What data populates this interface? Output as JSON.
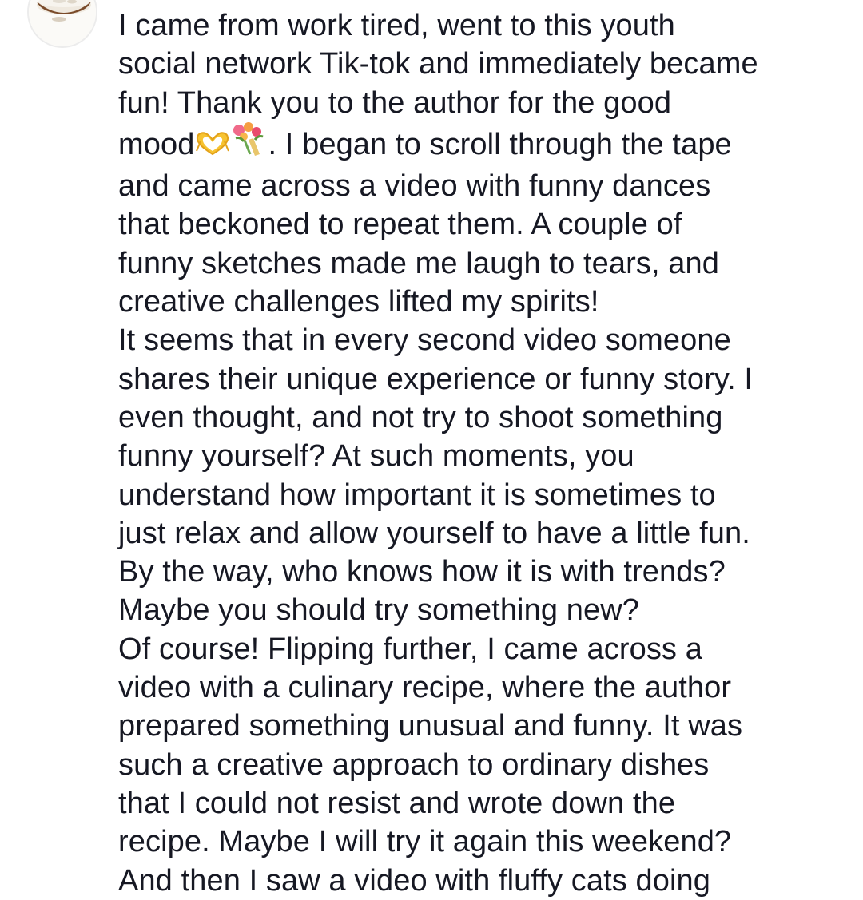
{
  "comment": {
    "avatar_icon": "food-bowl-avatar-icon",
    "lines": {
      "l1": "I came from work tired, went to this youth",
      "l2": "social network Tik-tok and immediately became",
      "l3": "fun! Thank you to the author for the good",
      "l4a": "mood",
      "l4b": ". I began to scroll through the tape",
      "l5": "and came across a video with funny dances",
      "l6": "that beckoned to repeat them. A couple of",
      "l7": "funny sketches made me laugh to tears, and",
      "l8": "creative challenges lifted my spirits!",
      "l9": "It seems that in every second video someone",
      "l10": "shares their unique experience or funny story. I",
      "l11": "even thought, and not try to shoot something",
      "l12": "funny yourself? At such moments, you",
      "l13": "understand how important it is sometimes to",
      "l14": "just relax and allow yourself to have a little fun.",
      "l15": "By the way, who knows how it is with trends?",
      "l16": "Maybe you should try something new?",
      "l17": "Of course! Flipping further, I came across a",
      "l18": "video with a culinary recipe, where the author",
      "l19": "prepared something unusual and funny. It was",
      "l20": "such a creative approach to ordinary dishes",
      "l21": "that I could not resist and wrote down the",
      "l22": "recipe. Maybe I will try it again this weekend?",
      "l23": "And then I saw a video with fluffy cats doing"
    },
    "emojis": [
      "heart-hands-icon",
      "bouquet-icon"
    ],
    "colors": {
      "text": "#161823",
      "background": "#ffffff"
    }
  }
}
